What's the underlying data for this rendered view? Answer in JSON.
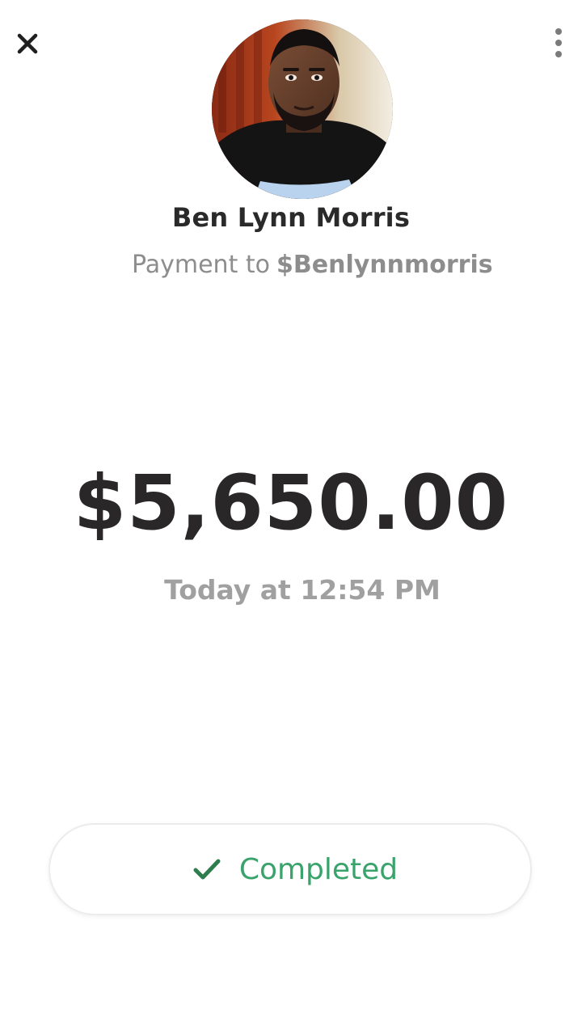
{
  "header": {
    "close_icon": "close-icon",
    "more_icon": "more-vertical-icon"
  },
  "recipient": {
    "avatar_icon": "profile-photo",
    "name": "Ben Lynn Morris",
    "payment_prefix": "Payment to",
    "handle": "$Benlynnmorris"
  },
  "payment": {
    "amount": "$5,650.00",
    "timestamp": "Today at 12:54 PM"
  },
  "status": {
    "icon": "check-icon",
    "label": "Completed",
    "color": "#3aa36b"
  }
}
